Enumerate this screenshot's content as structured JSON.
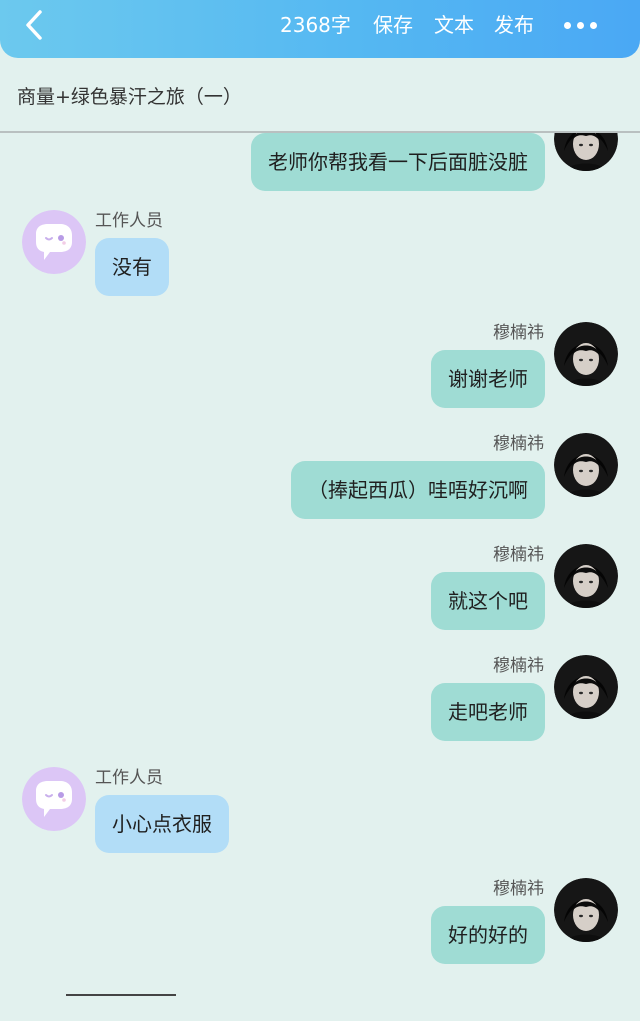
{
  "header": {
    "back_icon": "chevron-left-icon",
    "word_count": "2368字",
    "save_label": "保存",
    "text_label": "文本",
    "publish_label": "发布",
    "more_icon": "more-dots-icon"
  },
  "document": {
    "title": "商量+绿色暴汗之旅（一）"
  },
  "colors": {
    "header_start": "#6cc9ee",
    "header_end": "#4aa8f4",
    "background": "#e2f1ee",
    "bubble_self": "#9fdcd4",
    "bubble_other": "#b2ddf7",
    "staff_avatar": "#dcc6f6"
  },
  "messages": [
    {
      "side": "right",
      "sender": "",
      "text": "老师你帮我看一下后面脏没脏"
    },
    {
      "side": "left",
      "sender": "工作人员",
      "text": "没有"
    },
    {
      "side": "right",
      "sender": "穆楠祎",
      "text": "谢谢老师"
    },
    {
      "side": "right",
      "sender": "穆楠祎",
      "text": "（捧起西瓜）哇唔好沉啊"
    },
    {
      "side": "right",
      "sender": "穆楠祎",
      "text": "就这个吧"
    },
    {
      "side": "right",
      "sender": "穆楠祎",
      "text": "走吧老师"
    },
    {
      "side": "left",
      "sender": "工作人员",
      "text": "小心点衣服"
    },
    {
      "side": "right",
      "sender": "穆楠祎",
      "text": "好的好的"
    }
  ]
}
